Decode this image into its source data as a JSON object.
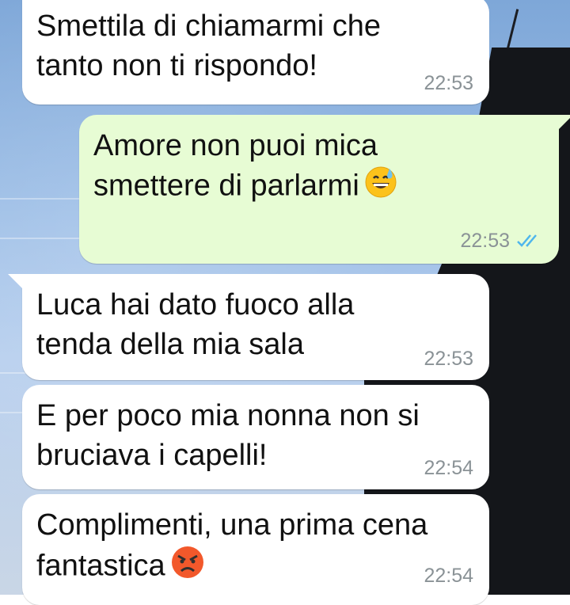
{
  "messages": [
    {
      "direction": "incoming",
      "text": "Smettila di chiamarmi che\ntanto non ti rispondo!",
      "time": "22:53"
    },
    {
      "direction": "outgoing",
      "text": "Amore non puoi mica\nsmettere di parlarmi",
      "emoji": "grinning-sweat-emoji",
      "time": "22:53",
      "status": "read"
    },
    {
      "direction": "incoming",
      "text": "Luca hai dato fuoco alla\ntenda della mia sala",
      "time": "22:53"
    },
    {
      "direction": "incoming",
      "text": "E per poco mia nonna non si\nbruciava i capelli!",
      "time": "22:54"
    },
    {
      "direction": "incoming",
      "text": "Complimenti, una prima cena\nfantastica",
      "emoji": "angry-face-emoji",
      "time": "22:54"
    }
  ],
  "colors": {
    "incoming_bubble": "#ffffff",
    "outgoing_bubble": "#e7fcd4",
    "timestamp": "#8a9296",
    "read_ticks": "#4fb6ec"
  }
}
